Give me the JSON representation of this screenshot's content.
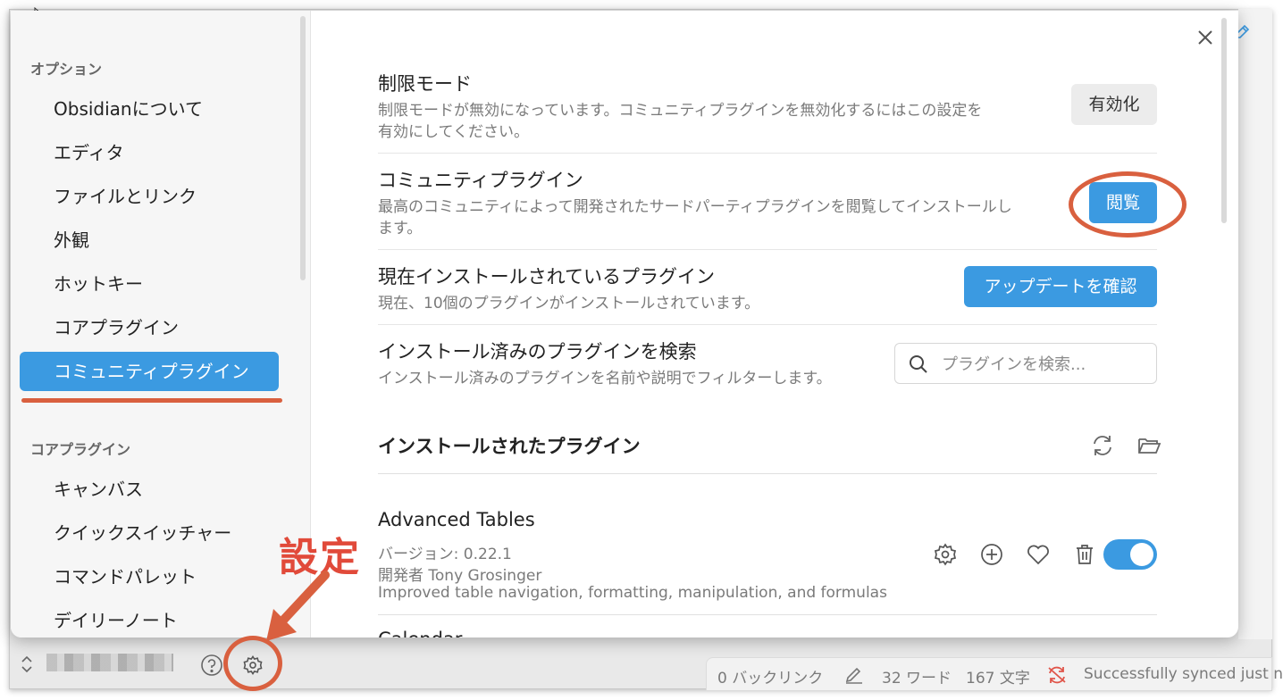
{
  "sidebar": {
    "options_heading": "オプション",
    "options_items": [
      {
        "label": "Obsidianについて"
      },
      {
        "label": "エディタ"
      },
      {
        "label": "ファイルとリンク"
      },
      {
        "label": "外観"
      },
      {
        "label": "ホットキー"
      },
      {
        "label": "コアプラグイン"
      },
      {
        "label": "コミュニティプラグイン",
        "active": true
      }
    ],
    "core_heading": "コアプラグイン",
    "core_items": [
      {
        "label": "キャンバス"
      },
      {
        "label": "クイックスイッチャー"
      },
      {
        "label": "コマンドパレット"
      },
      {
        "label": "デイリーノート"
      }
    ]
  },
  "settings": {
    "restricted_mode": {
      "name": "制限モード",
      "desc_line1": "制限モードが無効になっています。コミュニティプラグインを無効化するにはこの設定を",
      "desc_line2": "有効にしてください。",
      "button": "有効化"
    },
    "community_plugins": {
      "name": "コミュニティプラグイン",
      "desc_line1": "最高のコミュニティによって開発されたサードパーティプラグインを閲覧してインストールし",
      "desc_line2": "ます。",
      "button": "閲覧"
    },
    "installed_plugins": {
      "name": "現在インストールされているプラグイン",
      "desc": "現在、10個のプラグインがインストールされています。",
      "button": "アップデートを確認"
    },
    "search_installed": {
      "name": "インストール済みのプラグインを検索",
      "desc": "インストール済みのプラグインを名前や説明でフィルターします。",
      "placeholder": "プラグインを検索..."
    }
  },
  "installed_section": {
    "title": "インストールされたプラグイン",
    "plugins": [
      {
        "name": "Advanced Tables",
        "version": "バージョン: 0.22.1",
        "author": "開発者 Tony Grosinger",
        "description": "Improved table navigation, formatting, manipulation, and formulas",
        "enabled": true
      },
      {
        "name": "Calendar"
      }
    ]
  },
  "status_bar": {
    "backlinks": "0 バックリンク",
    "words": "32 ワード",
    "chars": "167 文字",
    "sync": "Successfully synced just no"
  },
  "annotation": {
    "label": "設定"
  },
  "colors": {
    "accent": "#3b9ae1",
    "annotation": "#d9603f",
    "annotation_text": "#e14a3a"
  }
}
